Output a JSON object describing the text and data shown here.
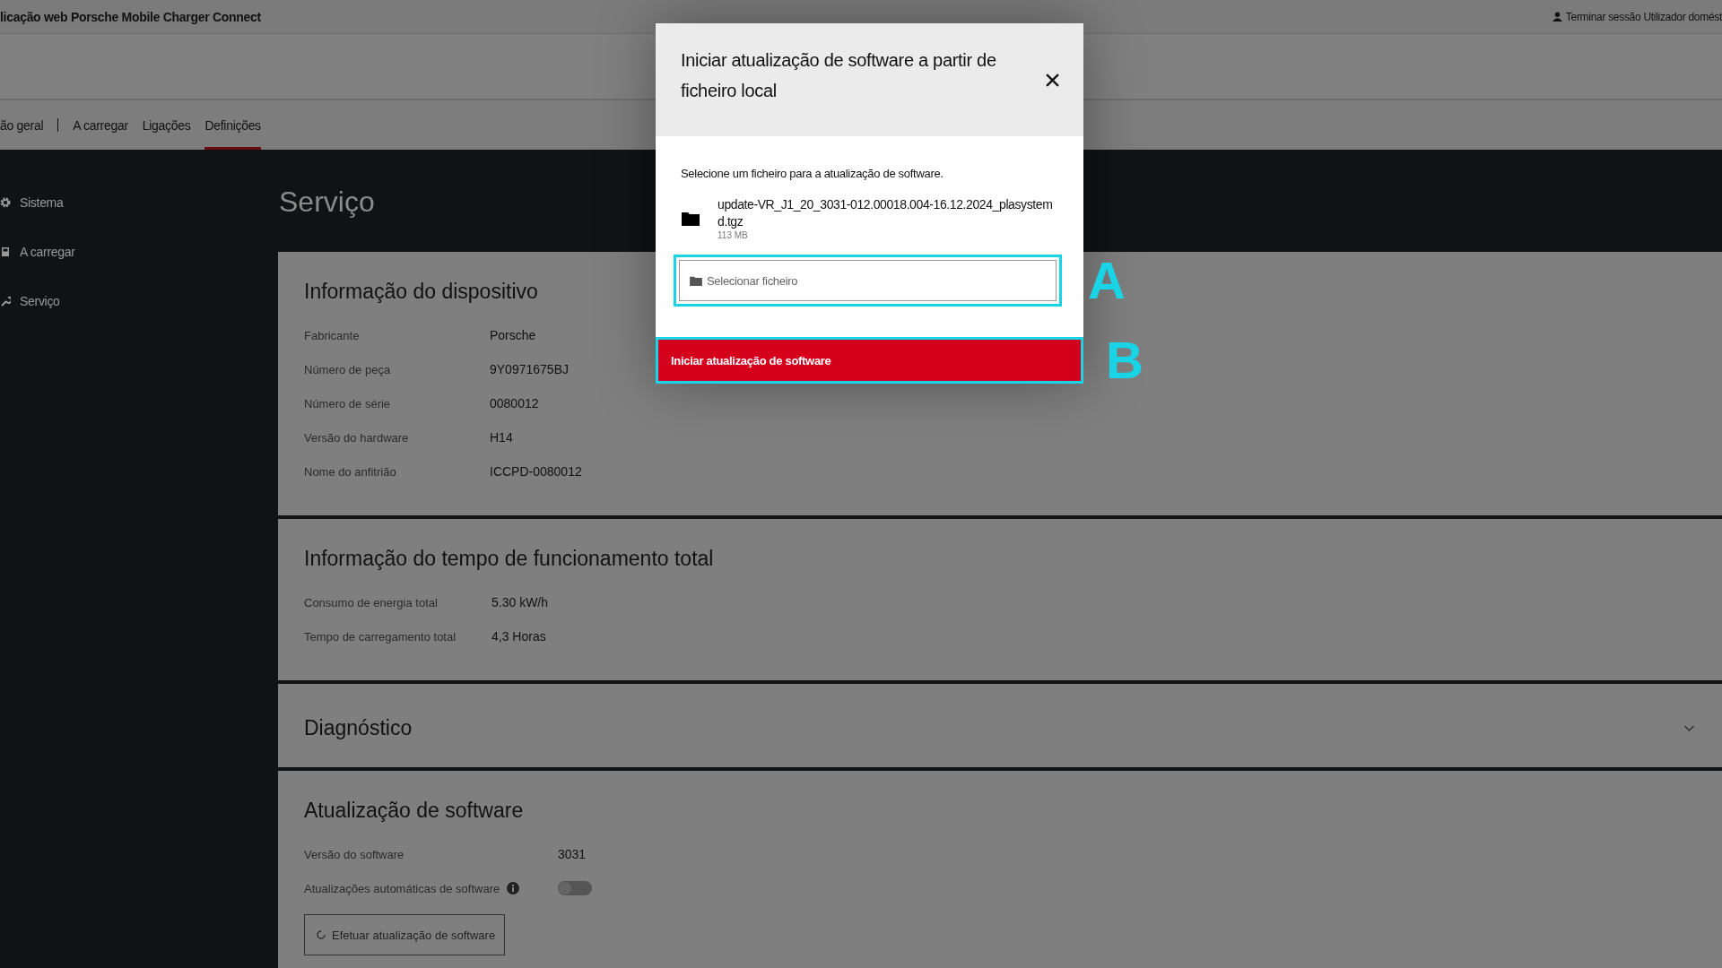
{
  "app_title": "licação web Porsche Mobile Charger Connect",
  "user_link": "Terminar sessão Utilizador domést",
  "tabs": [
    {
      "label": "ão geral",
      "selected": false
    },
    {
      "label": "A carregar",
      "selected": false
    },
    {
      "label": "Ligações",
      "selected": false
    },
    {
      "label": "Definições",
      "selected": true
    }
  ],
  "sidebar": {
    "items": [
      {
        "label": "Sistema",
        "kind": "gear"
      },
      {
        "label": "A carregar",
        "kind": "charger"
      },
      {
        "label": "Serviço",
        "kind": "wrench"
      }
    ]
  },
  "page_title": "Serviço",
  "sections": [
    {
      "title": "Informação do dispositivo",
      "rows": [
        {
          "label": "Fabricante",
          "value": "Porsche"
        },
        {
          "label": "Número de peça",
          "value": "9Y0971675BJ"
        },
        {
          "label": "Número de série",
          "value": "0080012"
        },
        {
          "label": "Versão do hardware",
          "value": "H14"
        },
        {
          "label": "Nome do anfitrião",
          "value": "ICCPD-0080012"
        }
      ]
    },
    {
      "title": "Informação do tempo de funcionamento total",
      "rows": [
        {
          "label": "Consumo de energia total",
          "value": "5.30 kW/h"
        },
        {
          "label": "Tempo de carregamento total",
          "value": "4,3 Horas"
        }
      ]
    },
    {
      "title": "Diagnóstico",
      "expanded": false
    },
    {
      "title": "Atualização de software",
      "rows": [
        {
          "label": "Versão do software",
          "value": "3031"
        }
      ],
      "auto_update": {
        "label": "Atualizações automáticas de software",
        "on": false
      },
      "button": "Efetuar atualização de software"
    }
  ],
  "dialog": {
    "title": "Iniciar atualização de software a partir de ficheiro local",
    "instruction": "Selecione um ficheiro para a atualização de software.",
    "file_name": "update-VR_J1_20_3031-012.00018.004-16.12.2024_plasystemd.tgz",
    "file_size": "113 MB",
    "picker_placeholder": "Selecionar ficheiro",
    "submit": "Iniciar atualização de software"
  },
  "callouts": [
    "A",
    "B"
  ]
}
